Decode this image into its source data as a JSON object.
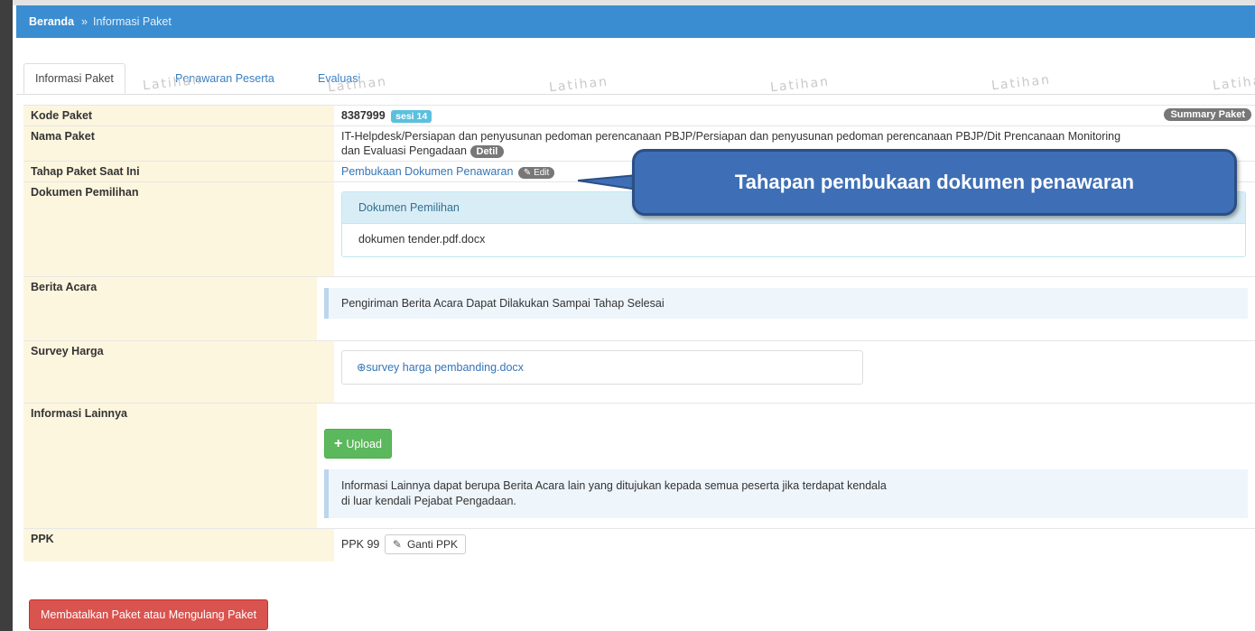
{
  "breadcrumb": {
    "home": "Beranda",
    "separator": "»",
    "current": "Informasi Paket"
  },
  "tabs": [
    {
      "label": "Informasi Paket",
      "active": true
    },
    {
      "label": "Penawaran Peserta",
      "active": false
    },
    {
      "label": "Evaluasi",
      "active": false
    }
  ],
  "watermark": "Latihan",
  "kode_paket": {
    "label": "Kode Paket",
    "value": "8387999",
    "sesi": "sesi 14",
    "summary": "Summary Paket"
  },
  "nama_paket": {
    "label": "Nama Paket",
    "value_line1": "IT-Helpdesk/Persiapan dan penyusunan pedoman perencanaan PBJP/Persiapan dan penyusunan pedoman perencanaan PBJP/Dit Prencanaan Monitoring",
    "value_line2": "dan Evaluasi Pengadaan",
    "detil": "Detil"
  },
  "tahap": {
    "label": "Tahap Paket Saat Ini",
    "value": "Pembukaan Dokumen Penawaran",
    "edit": "Edit"
  },
  "dokumen": {
    "label": "Dokumen Pemilihan",
    "panel_title": "Dokumen Pemilihan",
    "file": "dokumen tender.pdf.docx"
  },
  "berita_acara": {
    "label": "Berita Acara",
    "info": "Pengiriman Berita Acara Dapat Dilakukan Sampai Tahap Selesai"
  },
  "survey": {
    "label": "Survey Harga",
    "file": "survey harga pembanding.docx"
  },
  "informasi_lainnya": {
    "label": "Informasi Lainnya",
    "upload": "Upload",
    "info_line1": "Informasi Lainnya dapat berupa Berita Acara lain yang ditujukan kepada semua peserta jika terdapat kendala",
    "info_line2": "di luar kendali Pejabat Pengadaan."
  },
  "ppk": {
    "label": "PPK",
    "value": "PPK 99",
    "ganti": "Ganti PPK"
  },
  "cancel_button": "Membatalkan Paket atau Mengulang Paket",
  "callout": "Tahapan pembukaan dokumen penawaran",
  "colors": {
    "header": "#3a8dd1",
    "label_bg": "#fdf6df",
    "callout": "#3e6fb6",
    "upload": "#5cb85c",
    "danger": "#d9534f"
  }
}
